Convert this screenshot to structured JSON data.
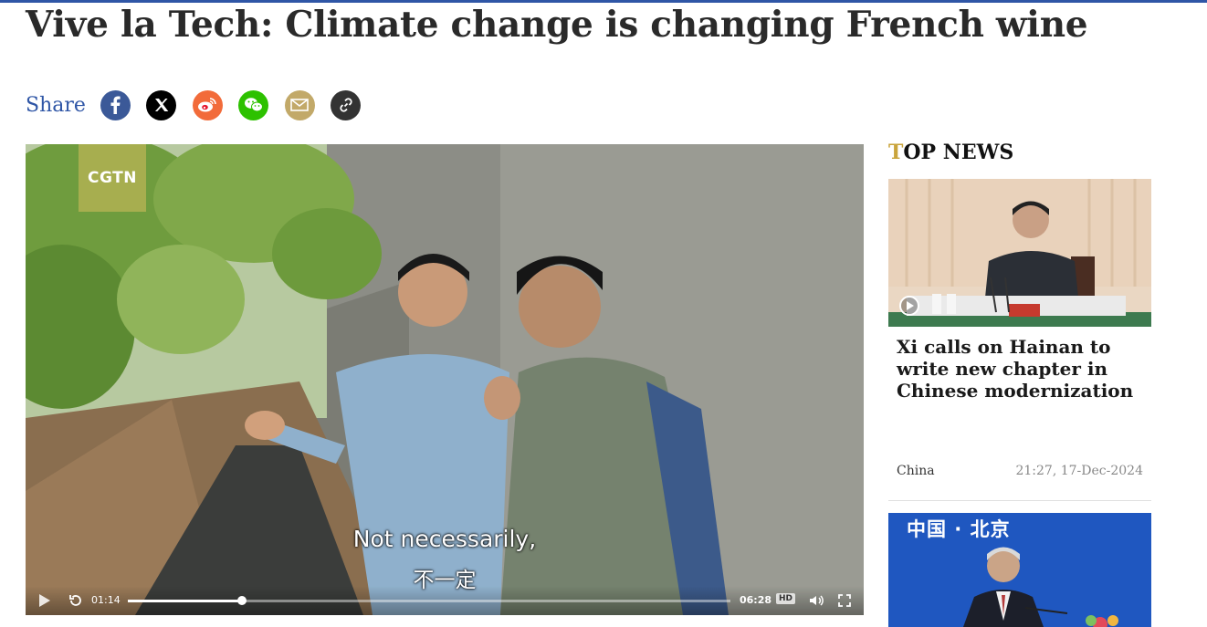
{
  "article": {
    "headline": "Vive la Tech: Climate change is changing French wine"
  },
  "share": {
    "label": "Share",
    "buttons": [
      {
        "name": "facebook-icon",
        "color": "#3b5998"
      },
      {
        "name": "x-twitter-icon",
        "color": "#000000"
      },
      {
        "name": "weibo-icon",
        "color": "#e6162d"
      },
      {
        "name": "wechat-icon",
        "color": "#2dc100"
      },
      {
        "name": "email-icon",
        "color": "#c2a969"
      },
      {
        "name": "link-icon",
        "color": "#333333"
      }
    ]
  },
  "video": {
    "logo": "CGTN",
    "subtitle_en": "Not necessarily,",
    "subtitle_zh": "不一定",
    "current_time": "01:14",
    "duration": "06:28",
    "progress_fraction": 0.19,
    "hd_label": "HD"
  },
  "sidebar": {
    "title_first_letter": "T",
    "title_rest": "OP NEWS",
    "cards": [
      {
        "title": "Xi calls on Hainan to write new chapter in Chinese modernization",
        "category": "China",
        "timestamp": "21:27, 17-Dec-2024",
        "thumb_has_play": true
      },
      {
        "thumb_caption": "中国 · 北京"
      }
    ]
  },
  "colors": {
    "accent_blue": "#2f56a6",
    "top_news_accent": "#c9a43b"
  }
}
